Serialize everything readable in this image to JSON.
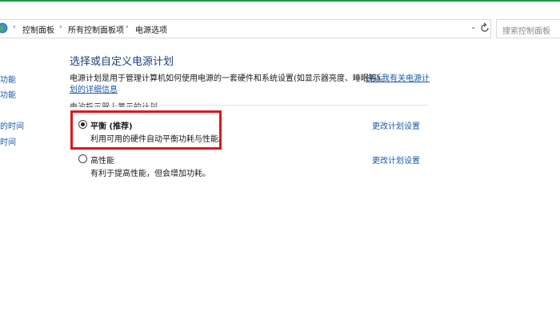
{
  "window": {
    "accent_color": "#1d9a4a"
  },
  "address_bar": {
    "breadcrumbs": [
      "控制面板",
      "所有控制面板项",
      "电源选项"
    ],
    "separator_glyph": "›",
    "dropdown_glyph": "⌄",
    "search_placeholder": "搜索控制面板"
  },
  "left_nav": {
    "items": [
      "功能",
      "功能",
      "的时间",
      "时间"
    ]
  },
  "main": {
    "title": "选择或自定义电源计划",
    "description": "电源计划是用于管理计算机如何使用电源的一套硬件和系统设置(如显示器亮度、睡眠等)。",
    "link_part1": "告诉我有关电源计",
    "link_part2": "划的详细信息",
    "section_heading": "电池指示器上显示的计划",
    "plans": [
      {
        "name": "平衡 (推荐)",
        "description": "利用可用的硬件自动平衡功耗与性能。",
        "selected": true,
        "settings_link": "更改计划设置"
      },
      {
        "name": "高性能",
        "description": "有利于提高性能，但会增加功耗。",
        "selected": false,
        "settings_link": "更改计划设置"
      }
    ],
    "highlight_color": "#e0161b"
  }
}
